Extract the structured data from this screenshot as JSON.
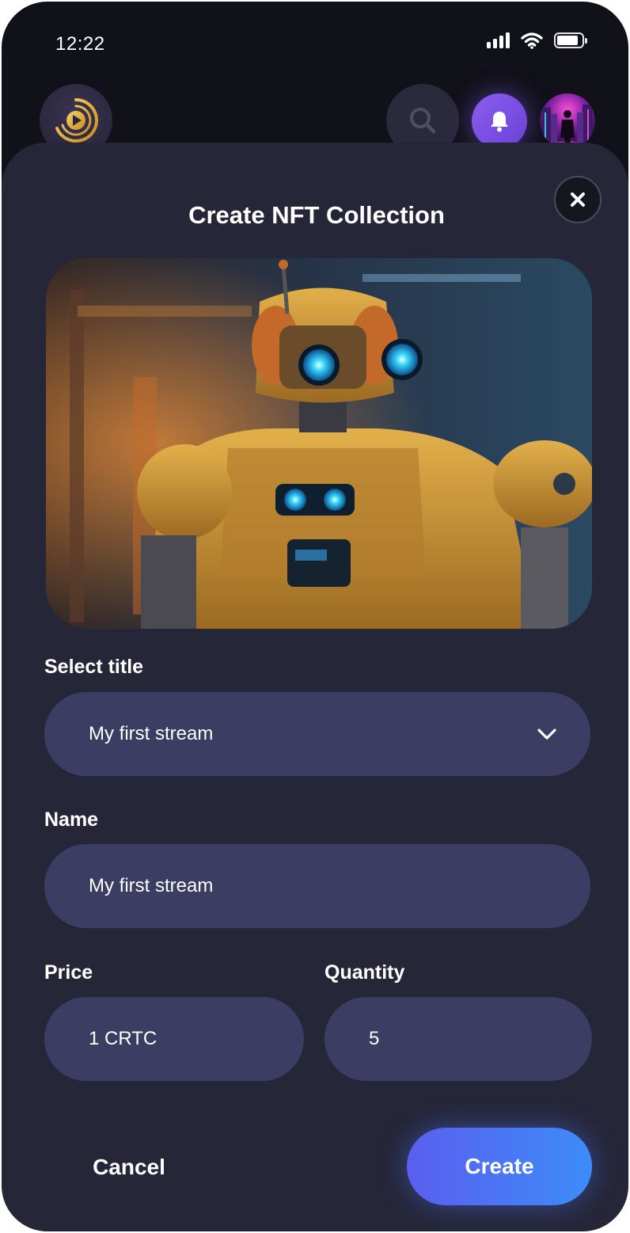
{
  "status_bar": {
    "time": "12:22"
  },
  "modal": {
    "title": "Create NFT Collection",
    "select_title": {
      "label": "Select title",
      "value": "My first stream"
    },
    "name": {
      "label": "Name",
      "value": "My first stream"
    },
    "price": {
      "label": "Price",
      "value": "1 CRTC"
    },
    "quantity": {
      "label": "Quantity",
      "value": "5"
    },
    "cancel_label": "Cancel",
    "create_label": "Create"
  },
  "icons": {
    "logo": "play-logo-icon",
    "search": "search-icon",
    "bell": "bell-icon",
    "close": "close-icon",
    "chevron": "chevron-down-icon"
  },
  "colors": {
    "background": "#111119",
    "sheet": "#262639",
    "field": "#3c3d63",
    "accent_start": "#5a5ef0",
    "accent_end": "#3d8cf8",
    "bell": "#7c4fe6",
    "logo_gold": "#e8b43a"
  }
}
